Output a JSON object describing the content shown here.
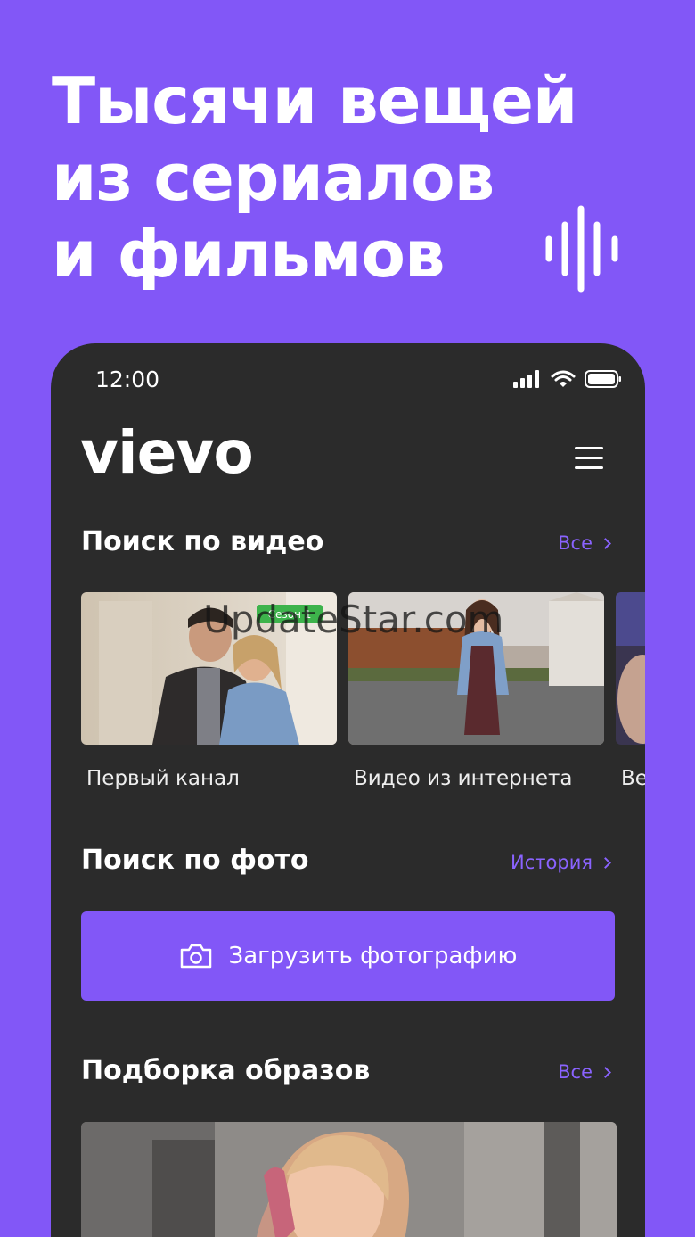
{
  "headline": {
    "line1": "Тысячи вещей",
    "line2": "из сериалов",
    "line3": "и фильмов"
  },
  "status_bar": {
    "time": "12:00"
  },
  "app": {
    "logo": "vievo"
  },
  "video_search": {
    "title": "Поиск по видео",
    "link": "Все",
    "cards": [
      {
        "label": "Первый канал",
        "badge": "Сезон 1"
      },
      {
        "label": "Видео из интернета"
      },
      {
        "label": "Ве"
      }
    ]
  },
  "photo_search": {
    "title": "Поиск по фото",
    "link": "История",
    "upload_label": "Загрузить фотографию"
  },
  "looks": {
    "title": "Подборка образов",
    "link": "Все"
  },
  "watermark": "UpdateStar.com",
  "colors": {
    "accent": "#8257f7",
    "panel": "#2b2b2b",
    "link": "#8a63ff"
  }
}
